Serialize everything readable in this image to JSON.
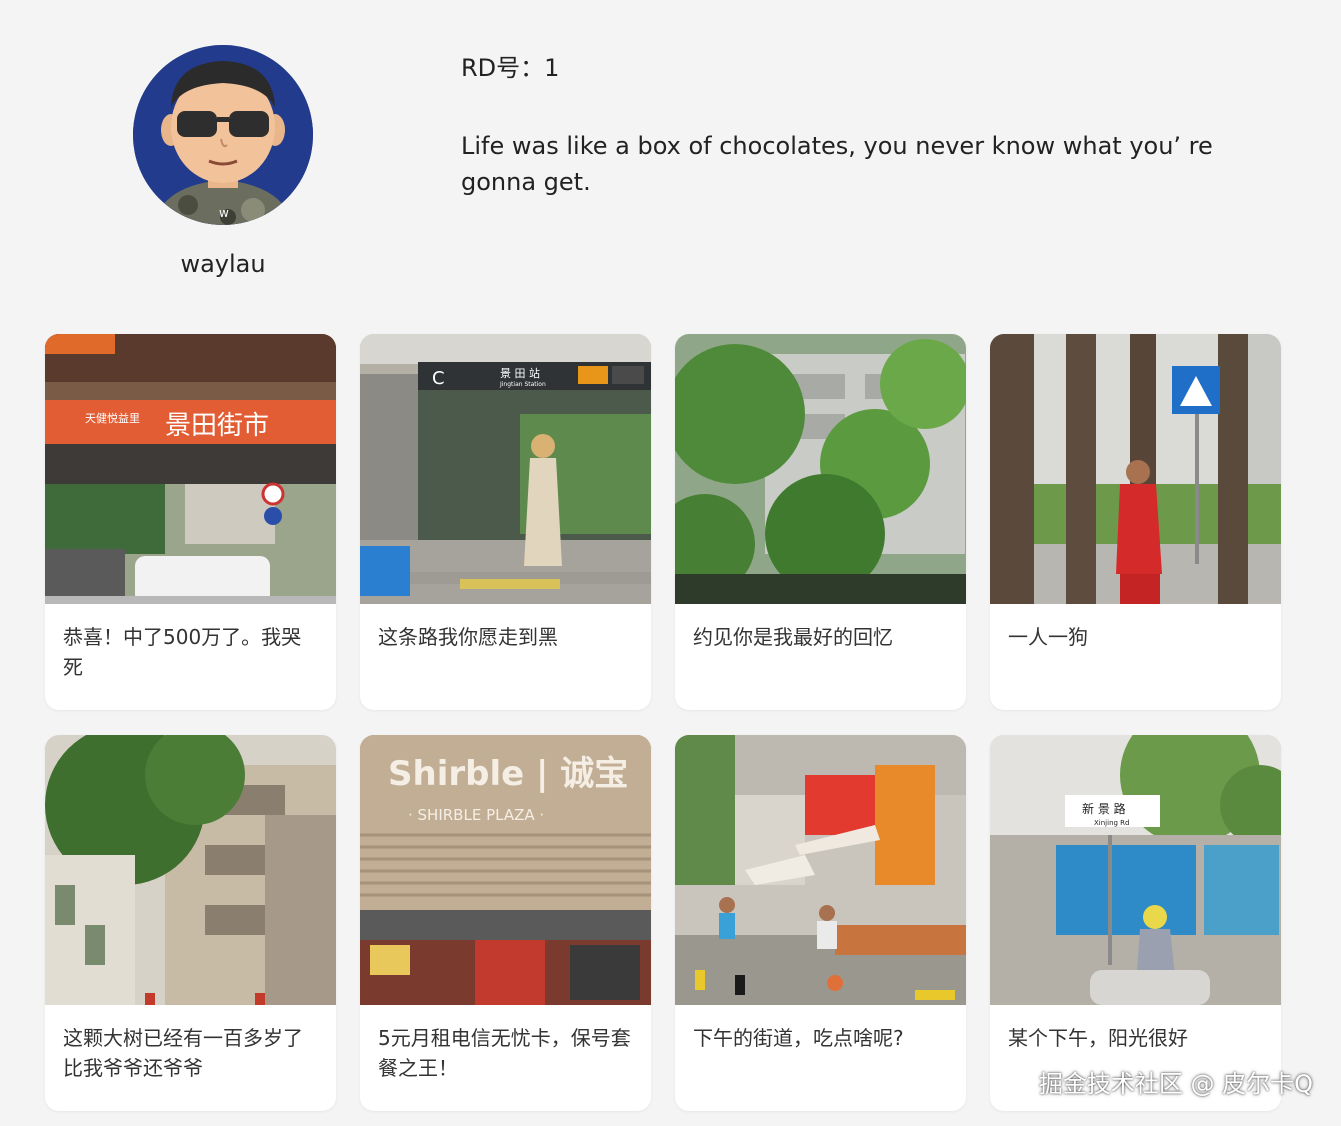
{
  "profile": {
    "username": "waylau",
    "rd_number": "RD号：1",
    "motto": "Life was like a box of chocolates, you never know what you’ re gonna get."
  },
  "cards": [
    {
      "title": "恭喜！中了500万了。我哭死",
      "photo_sign_title": "景田街市",
      "photo_sign_sub": "天健悦益里"
    },
    {
      "title": "这条路我你愿走到黑",
      "photo_sign_title": "景 田 站",
      "photo_sign_sub": "Jingtian Station",
      "photo_sign_letter": "C"
    },
    {
      "title": "约见你是我最好的回忆"
    },
    {
      "title": "一人一狗"
    },
    {
      "title": "这颗大树已经有一百多岁了比我爷爷还爷爷"
    },
    {
      "title": "5元月租电信无忧卡，保号套餐之王！",
      "photo_sign_title": "Shirble | 诚宝",
      "photo_sign_sub": "· SHIRBLE  PLAZA ·"
    },
    {
      "title": "下午的街道，吃点啥呢?"
    },
    {
      "title": "某个下午，阳光很好",
      "photo_sign_title": "新 景 路",
      "photo_sign_sub": "Xinjing Rd"
    }
  ],
  "watermark": "掘金技术社区 @ 皮尔卡Q",
  "colors": {
    "background": "#f4f4f4",
    "card": "#ffffff",
    "avatar_bg": "#233b8c"
  }
}
